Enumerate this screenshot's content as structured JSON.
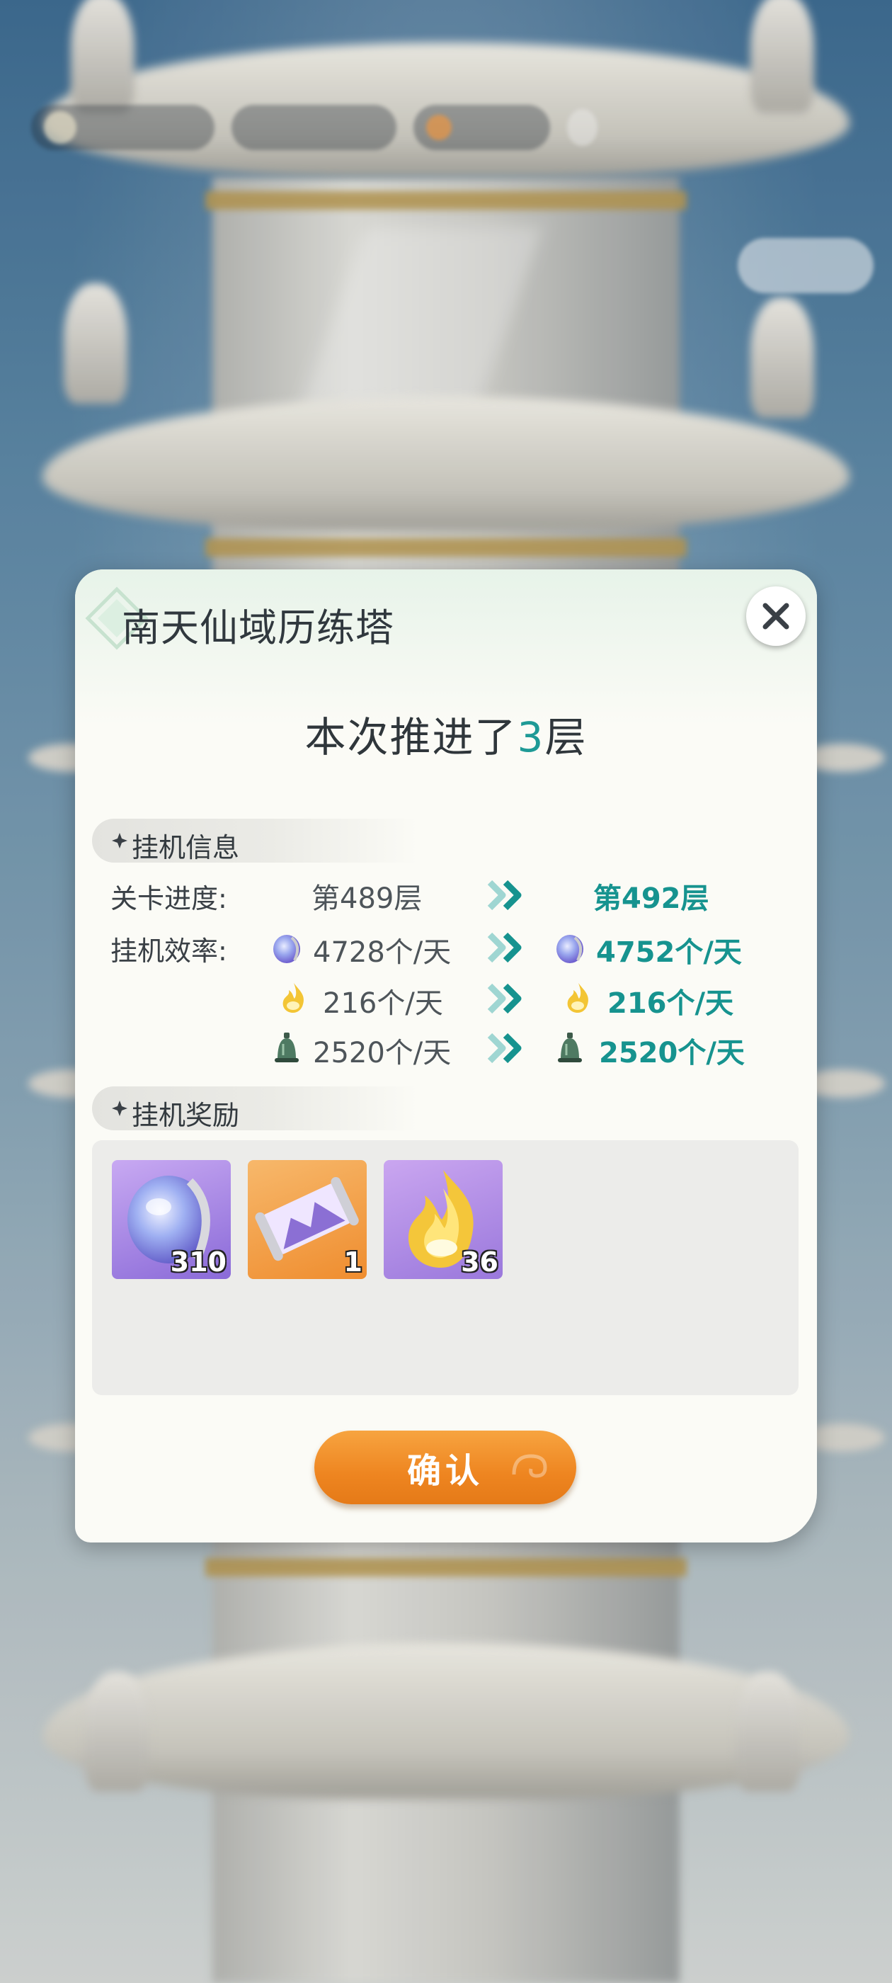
{
  "dialog": {
    "title": "南天仙域历练塔",
    "headline_prefix": "本次推进了",
    "headline_number": "3",
    "headline_suffix": "层"
  },
  "idle_info": {
    "section_label": "挂机信息",
    "progress_label": "关卡进度:",
    "progress_from": "第489层",
    "progress_to": "第492层",
    "efficiency_label": "挂机效率:",
    "rates": [
      {
        "icon": "spirit-stone-icon",
        "from": "4728个/天",
        "to": "4752个/天"
      },
      {
        "icon": "golden-flame-icon",
        "from": "216个/天",
        "to": "216个/天"
      },
      {
        "icon": "bronze-bell-icon",
        "from": "2520个/天",
        "to": "2520个/天"
      }
    ]
  },
  "rewards": {
    "section_label": "挂机奖励",
    "items": [
      {
        "name": "spirit-stone",
        "count": "310"
      },
      {
        "name": "scroll",
        "count": "1"
      },
      {
        "name": "golden-flame",
        "count": "36"
      }
    ]
  },
  "confirm_label": "确认",
  "colors": {
    "accent_teal": "#16938f",
    "button_orange": "#ee8520",
    "panel_bg": "#fbfbf6"
  }
}
